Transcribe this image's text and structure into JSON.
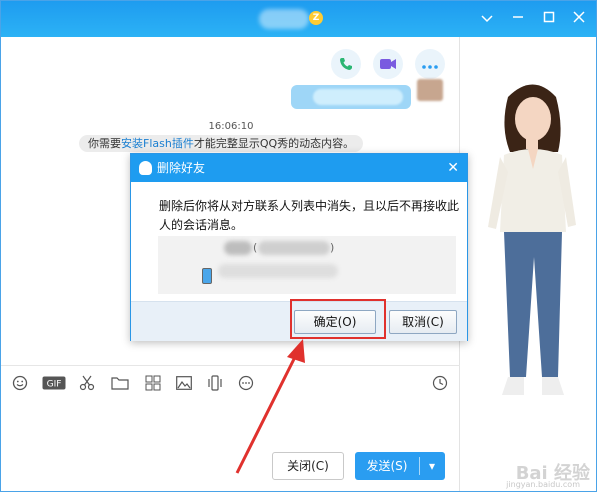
{
  "titlebar": {
    "badge": "Z",
    "minimize_icon": "minimize-icon",
    "maximize_icon": "maximize-icon",
    "close_icon": "close-icon",
    "dropdown_icon": "chevron-down-icon"
  },
  "chat": {
    "timestamp": "16:06:10",
    "notice_prefix": "你需要",
    "notice_link": "安装Flash插件",
    "notice_suffix": "才能完整显示QQ秀的动态内容。"
  },
  "dialog": {
    "title": "删除好友",
    "message": "删除后你将从对方联系人列表中消失，且以后不再接收此人的会话消息。",
    "paren_open": "(",
    "paren_close": ")",
    "ok_label": "确定(O)",
    "cancel_label": "取消(C)"
  },
  "footer": {
    "close_label": "关闭(C)",
    "send_label": "发送(S)",
    "send_arrow": "▾"
  },
  "watermark": {
    "text": "Bai 经验",
    "sub": "jingyan.baidu.com"
  },
  "colors": {
    "titlebar": "#1e9cf0",
    "accent": "#2a9df1",
    "highlight": "#e0312d"
  }
}
